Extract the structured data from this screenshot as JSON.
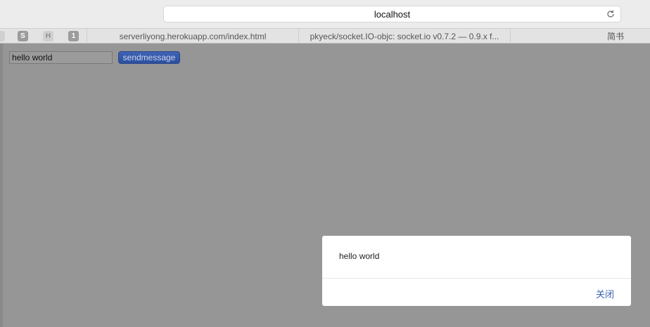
{
  "browser": {
    "address": "localhost",
    "favorites": [
      {
        "icon": "S"
      },
      {
        "icon": "H"
      },
      {
        "icon": "1"
      }
    ],
    "tabs": [
      {
        "label": "serverliyong.herokuapp.com/index.html"
      },
      {
        "label": "pkyeck/socket.IO-objc: socket.io v0.7.2 — 0.9.x f..."
      },
      {
        "label": "简书"
      }
    ]
  },
  "page": {
    "input_value": "hello world",
    "send_label": "sendmessage"
  },
  "dialog": {
    "message": "hello world",
    "close_label": "关闭"
  },
  "colors": {
    "overlay": "#969696",
    "button": "#2f54a6",
    "link": "#3a62b0"
  }
}
